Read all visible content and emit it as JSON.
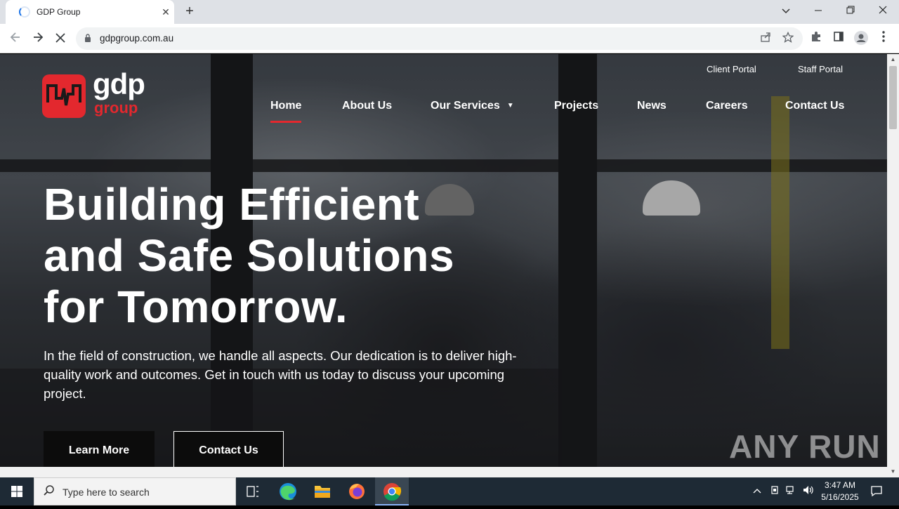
{
  "browser": {
    "tab_title": "GDP Group",
    "new_tab_symbol": "+",
    "close_tab_symbol": "✕",
    "url": "gdpgroup.com.au",
    "window_controls": {
      "dropdown": "⌄",
      "minimize": "—",
      "restore": "❐",
      "close": "✕"
    }
  },
  "site": {
    "logo": {
      "main": "gdp",
      "sub": "group"
    },
    "portals": [
      "Client Portal",
      "Staff Portal"
    ],
    "nav": [
      {
        "label": "Home",
        "active": true
      },
      {
        "label": "About Us",
        "active": false
      },
      {
        "label": "Our Services",
        "active": false,
        "has_dropdown": true
      },
      {
        "label": "Projects",
        "active": false
      },
      {
        "label": "News",
        "active": false
      },
      {
        "label": "Careers",
        "active": false
      },
      {
        "label": "Contact Us",
        "active": false
      }
    ],
    "hero": {
      "title_lines": [
        "Building Efficient",
        "and Safe Solutions",
        "for Tomorrow."
      ],
      "text": "In the field of construction, we handle all aspects. Our dedication is to deliver high-quality work and outcomes. Get in touch with us today to discuss your upcoming project.",
      "buttons": {
        "learn_more": "Learn More",
        "contact": "Contact Us"
      }
    },
    "watermark": "ANY RUN",
    "accent_color": "#e3282e"
  },
  "taskbar": {
    "search_placeholder": "Type here to search",
    "time": "3:47 AM",
    "date": "5/16/2025"
  }
}
